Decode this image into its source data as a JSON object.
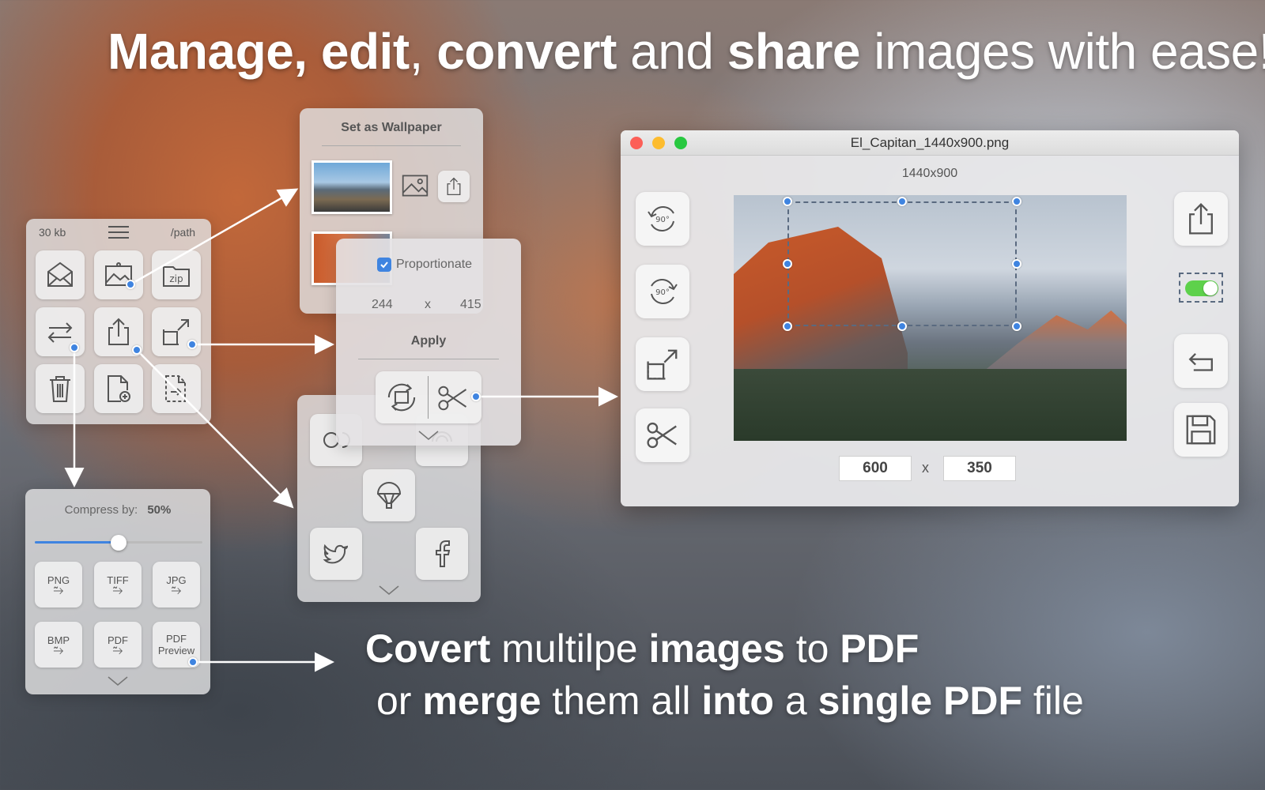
{
  "headline": {
    "w1": "Manage,",
    "w2": "edit",
    "w3": ",",
    "w4": "convert",
    "w5": "and",
    "w6": "share",
    "w7": "images with ease!"
  },
  "footer": {
    "line1": {
      "w1": "Covert",
      "w2": "multilpe",
      "w3": "images",
      "w4": "to",
      "w5": "PDF"
    },
    "line2": {
      "w1": "or",
      "w2": "merge",
      "w3": "them all",
      "w4": "into",
      "w5": "a",
      "w6": "single PDF",
      "w7": "file"
    }
  },
  "main_panel": {
    "size_label": "30 kb",
    "path_label": "/path"
  },
  "compress_panel": {
    "label": "Compress by:",
    "value": "50%",
    "slider_fraction": 0.5,
    "formats": [
      {
        "name": "PNG"
      },
      {
        "name": "TIFF"
      },
      {
        "name": "JPG"
      },
      {
        "name": "BMP"
      },
      {
        "name": "PDF"
      },
      {
        "name": "PDF",
        "sub": "Preview"
      }
    ],
    "arrow_glyph": "⥲"
  },
  "wallpaper_panel": {
    "title": "Set as Wallpaper"
  },
  "resize_panel": {
    "checkbox_label": "Proportionate",
    "checked": true,
    "width": "244",
    "x": "x",
    "height": "415",
    "apply_label": "Apply"
  },
  "window": {
    "title": "El_Capitan_1440x900.png",
    "dimensions": "1440x900",
    "width_value": "600",
    "times": "x",
    "height_value": "350",
    "rotate_label": "90°",
    "toggle_on": true,
    "colors": {
      "close": "#fc5f57",
      "minimize": "#fdbc2e",
      "maximize": "#28c840",
      "toggle": "#5ed14b",
      "accent": "#3f84e0"
    }
  }
}
